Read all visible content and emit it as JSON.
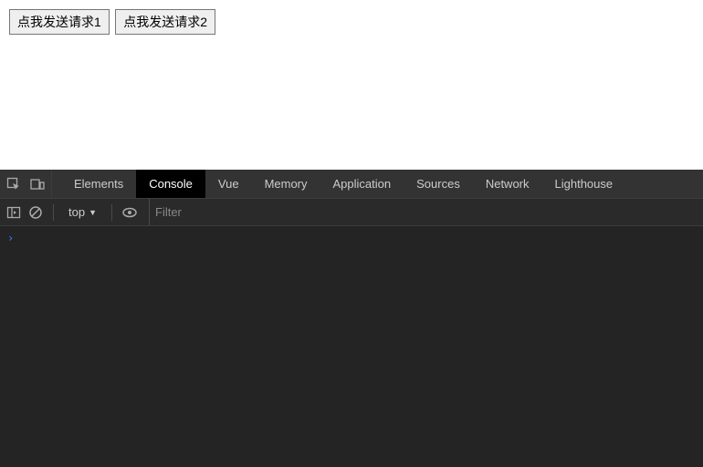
{
  "page": {
    "buttons": [
      {
        "label": "点我发送请求1"
      },
      {
        "label": "点我发送请求2"
      }
    ]
  },
  "devtools": {
    "tabs": [
      {
        "label": "Elements",
        "active": false
      },
      {
        "label": "Console",
        "active": true
      },
      {
        "label": "Vue",
        "active": false
      },
      {
        "label": "Memory",
        "active": false
      },
      {
        "label": "Application",
        "active": false
      },
      {
        "label": "Sources",
        "active": false
      },
      {
        "label": "Network",
        "active": false
      },
      {
        "label": "Lighthouse",
        "active": false
      }
    ],
    "console": {
      "context": "top",
      "filter_placeholder": "Filter",
      "prompt": "›"
    }
  }
}
